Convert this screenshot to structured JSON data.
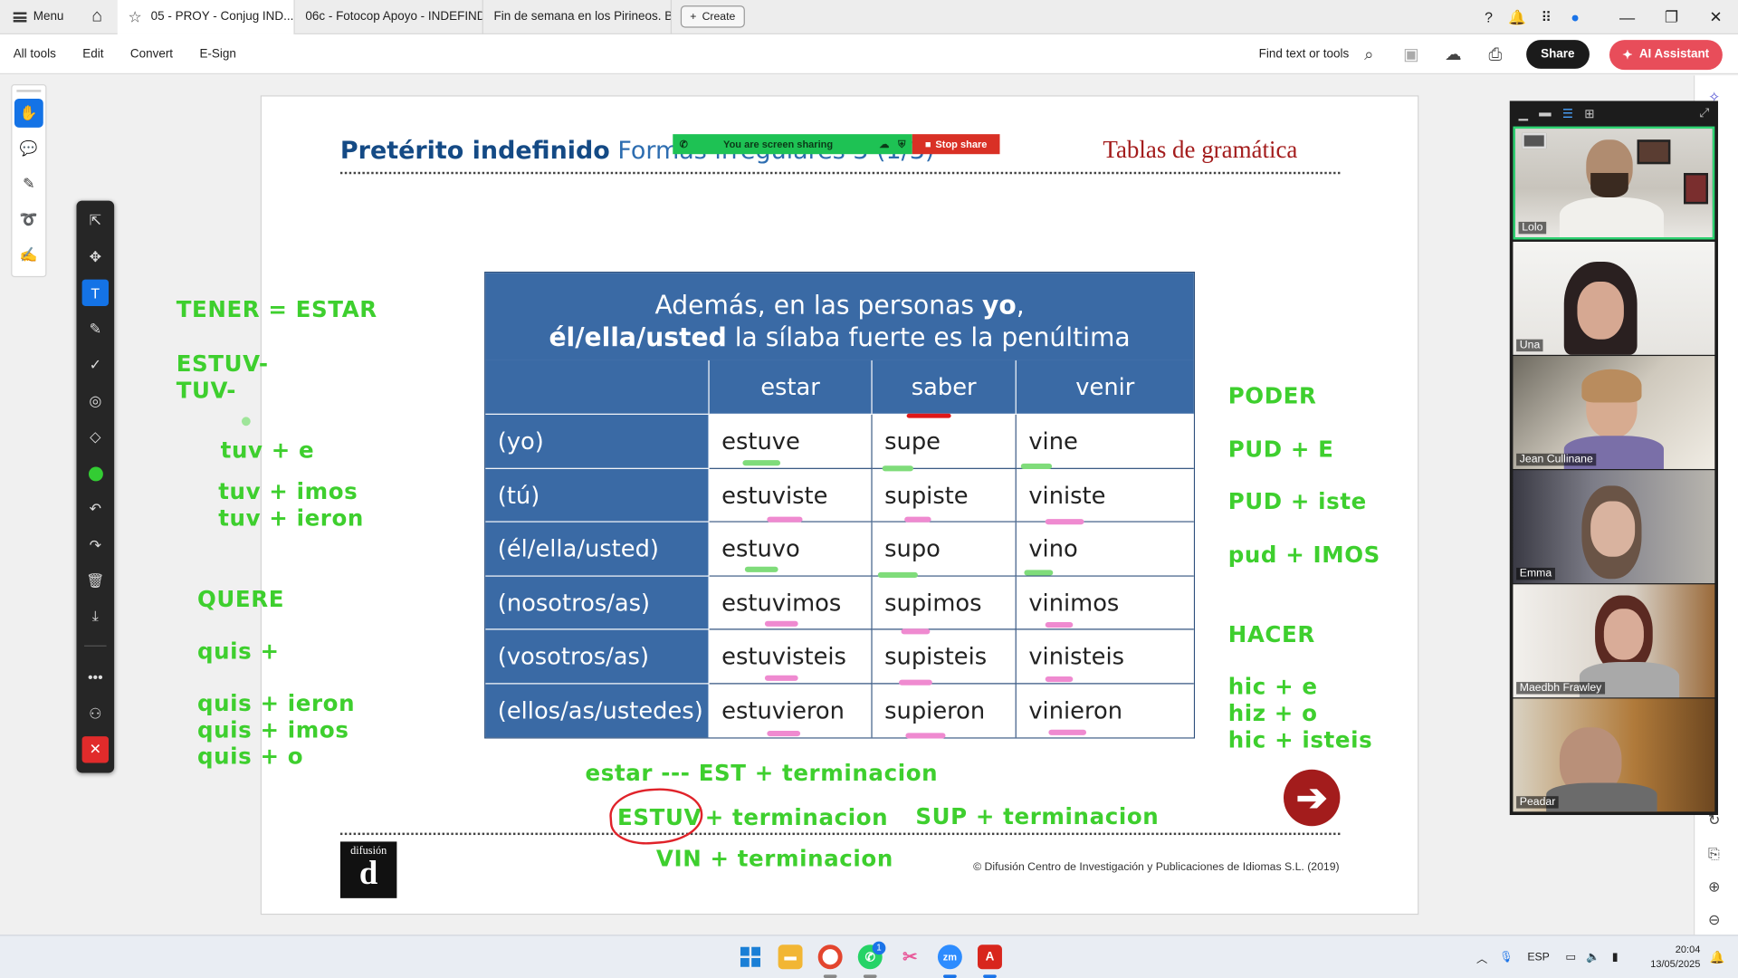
{
  "tabbar": {
    "menu_label": "Menu",
    "tabs": [
      {
        "label": "05 - PROY - Conjug IND..."
      },
      {
        "label": "06c - Fotocop Apoyo - INDEFIND..."
      },
      {
        "label": "Fin de semana en los Pirineos. B..."
      }
    ],
    "create_label": "Create"
  },
  "toolbar": {
    "menu": [
      "All tools",
      "Edit",
      "Convert",
      "E-Sign"
    ],
    "find_label": "Find text or tools",
    "share_label": "Share",
    "ai_label": "AI Assistant"
  },
  "sharebar": {
    "status": "You are screen sharing",
    "stop": "Stop share"
  },
  "doc": {
    "title_bold": "Pretérito indefinido",
    "title_light": "Formas irregulares 3 (1/3)",
    "section": "Tablas de gramática",
    "banner_line1_pre": "Además, en las personas ",
    "banner_line1_bold": "yo",
    "banner_line1_post": ",",
    "banner_line2_bold": "él/ella/usted",
    "banner_line2_post": " la sílaba fuerte es la penúltima",
    "verbs": [
      "estar",
      "saber",
      "venir"
    ],
    "rows": [
      {
        "pron": "(yo)",
        "vals": [
          "estuve",
          "supe",
          "vine"
        ]
      },
      {
        "pron": "(tú)",
        "vals": [
          "estuviste",
          "supiste",
          "viniste"
        ]
      },
      {
        "pron": "(él/ella/usted)",
        "vals": [
          "estuvo",
          "supo",
          "vino"
        ]
      },
      {
        "pron": "(nosotros/as)",
        "vals": [
          "estuvimos",
          "supimos",
          "vinimos"
        ]
      },
      {
        "pron": "(vosotros/as)",
        "vals": [
          "estuvisteis",
          "supisteis",
          "vinisteis"
        ]
      },
      {
        "pron": "(ellos/as/ustedes)",
        "vals": [
          "estuvieron",
          "supieron",
          "vinieron"
        ]
      }
    ],
    "logo_text": "difusión",
    "logo_letter": "d",
    "copyright": "© Difusión Centro de Investigación y Publicaciones de Idiomas S.L. (2019)"
  },
  "notes": {
    "left": [
      "TENER = ESTAR",
      "ESTUV-",
      "TUV-",
      "tuv + e",
      "tuv + imos",
      "tuv + ieron",
      "QUERE",
      "quis +",
      "quis + ieron",
      "quis + imos",
      "quis + o"
    ],
    "right": [
      "PODER",
      "PUD + E",
      "PUD + iste",
      "pud + IMOS",
      "HACER",
      "hic + e",
      "hiz + o",
      "hic + isteis"
    ],
    "bottom": [
      "estar --- EST + terminacion",
      "ESTUV",
      "+ terminacion",
      "SUP + terminacion",
      "VIN + terminacion"
    ]
  },
  "participants": [
    "Lolo",
    "Una",
    "Jean Cullinane",
    "Emma",
    "Maedbh Frawley",
    "Peadar"
  ],
  "taskbar": {
    "lang": "ESP",
    "time": "20:04",
    "date": "13/05/2025",
    "whatsapp_badge": "1"
  },
  "colors": {
    "note_green": "#3ecf2e",
    "table_blue": "#3a6aa5",
    "title_blue": "#1d5fa3",
    "section_red": "#a31c1c",
    "highlight_green": "#7fdc7a",
    "highlight_pink": "#ef8ad0"
  }
}
